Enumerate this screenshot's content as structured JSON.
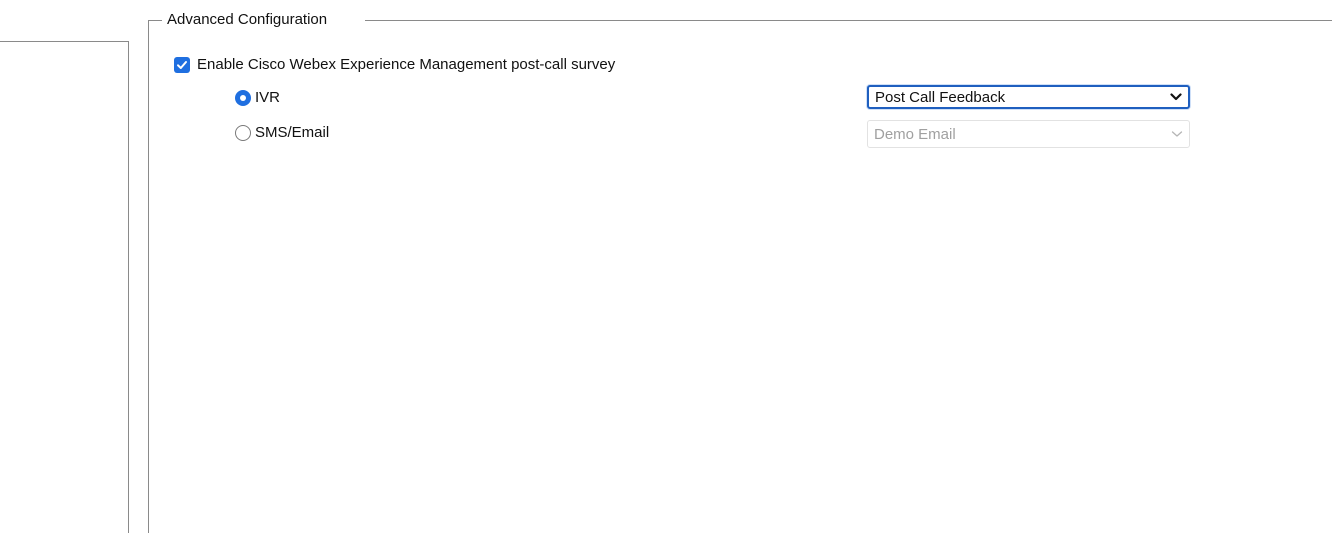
{
  "group": {
    "legend": "Advanced Configuration"
  },
  "survey": {
    "checkbox_label": "Enable Cisco Webex Experience Management post-call survey",
    "checked": true
  },
  "options": {
    "ivr": {
      "label": "IVR",
      "selected": true,
      "dropdown_value": "Post Call Feedback"
    },
    "sms_email": {
      "label": "SMS/Email",
      "selected": false,
      "dropdown_value": "Demo Email"
    }
  },
  "icons": {
    "checkbox": "checkmark-icon",
    "select_active": "chevron-down-icon",
    "select_disabled": "chevron-down-icon"
  },
  "colors": {
    "accent": "#1f6fe0",
    "frame": "#8a8a8a",
    "disabled_text": "#a0a0a0"
  }
}
